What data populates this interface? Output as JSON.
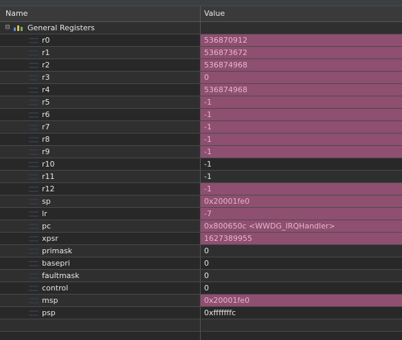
{
  "header": {
    "name_label": "Name",
    "value_label": "Value"
  },
  "group": {
    "label": "General Registers"
  },
  "registers": [
    {
      "name": "r0",
      "value": "536870912",
      "changed": true
    },
    {
      "name": "r1",
      "value": "536873672",
      "changed": true
    },
    {
      "name": "r2",
      "value": "536874968",
      "changed": true
    },
    {
      "name": "r3",
      "value": "0",
      "changed": true
    },
    {
      "name": "r4",
      "value": "536874968",
      "changed": true
    },
    {
      "name": "r5",
      "value": "-1",
      "changed": true
    },
    {
      "name": "r6",
      "value": "-1",
      "changed": true
    },
    {
      "name": "r7",
      "value": "-1",
      "changed": true
    },
    {
      "name": "r8",
      "value": "-1",
      "changed": true
    },
    {
      "name": "r9",
      "value": "-1",
      "changed": true
    },
    {
      "name": "r10",
      "value": "-1",
      "changed": false
    },
    {
      "name": "r11",
      "value": "-1",
      "changed": false
    },
    {
      "name": "r12",
      "value": "-1",
      "changed": true
    },
    {
      "name": "sp",
      "value": "0x20001fe0",
      "changed": true
    },
    {
      "name": "lr",
      "value": "-7",
      "changed": true
    },
    {
      "name": "pc",
      "value": "0x800650c <WWDG_IRQHandler>",
      "changed": true
    },
    {
      "name": "xpsr",
      "value": "1627389955",
      "changed": true
    },
    {
      "name": "primask",
      "value": "0",
      "changed": false
    },
    {
      "name": "basepri",
      "value": "0",
      "changed": false
    },
    {
      "name": "faultmask",
      "value": "0",
      "changed": false
    },
    {
      "name": "control",
      "value": "0",
      "changed": false
    },
    {
      "name": "msp",
      "value": "0x20001fe0",
      "changed": true
    },
    {
      "name": "psp",
      "value": "0xfffffffc",
      "changed": false
    }
  ],
  "colors": {
    "changed_bg": "#8e4f70",
    "changed_text": "#e9b6d0"
  }
}
